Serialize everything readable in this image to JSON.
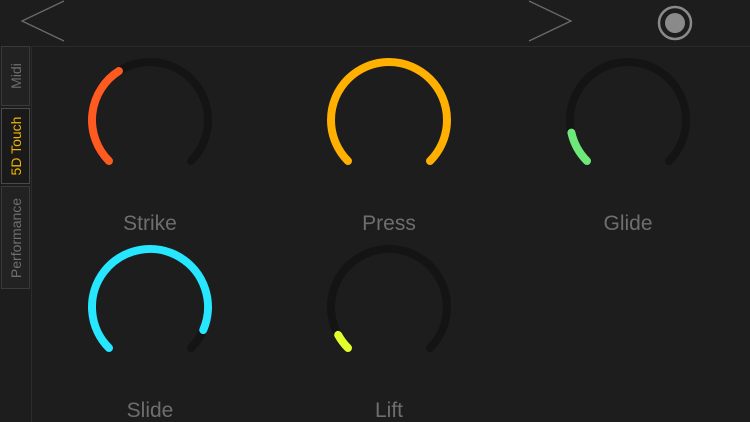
{
  "nav": {
    "prev_icon": "chevron-left-icon",
    "next_icon": "chevron-right-icon",
    "record_icon": "record-icon"
  },
  "sidebar": {
    "tabs": [
      {
        "label": "Midi",
        "active": false
      },
      {
        "label": "5D Touch",
        "active": true
      },
      {
        "label": "Performance",
        "active": false
      }
    ]
  },
  "knobs": [
    {
      "label": "Strike",
      "value": 0.38,
      "color": "#ff5a1f"
    },
    {
      "label": "Press",
      "value": 1.0,
      "color": "#ffb000"
    },
    {
      "label": "Glide",
      "value": 0.12,
      "color": "#6ee87a"
    },
    {
      "label": "Slide",
      "value": 0.92,
      "color": "#27e6ff"
    },
    {
      "label": "Lift",
      "value": 0.06,
      "color": "#e4ff2e"
    }
  ],
  "colors": {
    "background": "#1d1d1d",
    "track": "#141414",
    "label": "#6e6e6e",
    "active_tab": "#f0b400"
  }
}
